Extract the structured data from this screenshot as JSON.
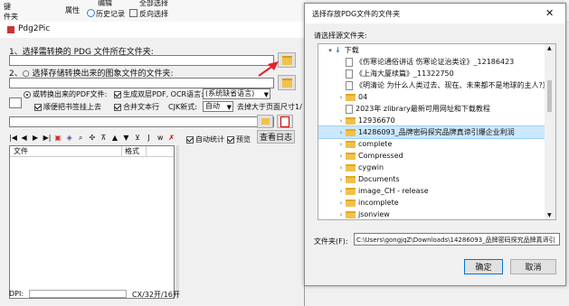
{
  "background_ribbon": {
    "key_fragment": "键",
    "folder_fragment": "件夹",
    "properties": "属性",
    "edit": "编辑",
    "history": "历史记录",
    "select_all": "全部选择",
    "invert_selection": "反向选择"
  },
  "pdg": {
    "title": "Pdg2Pic",
    "step1_label": "1、选择需转换的 PDG 文件所在文件夹:",
    "step2_label": "2、○ 选择存储转换出来的图象文件的文件夹:",
    "pdf_radio_label": "或转换出来的PDF文件:",
    "generate_pdf": "生成双层PDF, OCR语言:",
    "ocr_language": "(系统缺省语言)",
    "order_bookmark": "顺便把书签挂上去",
    "merge_text": "合并文本行",
    "cjk_label": "CJK新式:",
    "cjk_value": "自动",
    "page_size_label": "去掉大于页面尺寸1/",
    "auto_count": "自动统计",
    "preview": "预览",
    "view_log": "查看日志",
    "columns": [
      "文件",
      "格式"
    ],
    "dpi_label": "DPI:",
    "status_right": "CX/32开/16开"
  },
  "dialog": {
    "title": "选择存放PDG文件的文件夹",
    "close": "✕",
    "prompt": "请选择源文件夹:",
    "tree": [
      {
        "label": "下载",
        "type": "root"
      },
      {
        "label": "《伤寒论通俗讲话 伤寒论证治类诠》_12186423",
        "type": "doc"
      },
      {
        "label": "《上海大厦续篇》_11322750",
        "type": "doc"
      },
      {
        "label": "《明清论 为什么人类过去、现在、未来都不是地球的主人?》",
        "type": "doc"
      },
      {
        "label": "04",
        "type": "folder"
      },
      {
        "label": "2023年 zlibrary最新可用网址和下载教程",
        "type": "doc"
      },
      {
        "label": "12936670",
        "type": "folder"
      },
      {
        "label": "14286093_品牌密码探究品牌真谛引爆企业利润",
        "type": "selected"
      },
      {
        "label": "complete",
        "type": "folder"
      },
      {
        "label": "Compressed",
        "type": "folder"
      },
      {
        "label": "cygwin",
        "type": "folder"
      },
      {
        "label": "Documents",
        "type": "folder"
      },
      {
        "label": "image_CH - release",
        "type": "folder"
      },
      {
        "label": "incomplete",
        "type": "folder"
      },
      {
        "label": "jsonview",
        "type": "folder"
      }
    ],
    "folder_label": "文件夹(F):",
    "folder_value": "C:\\Users\\gongjqZ\\Downloads\\14286093_品牌密码探究品牌真谛引",
    "ok": "确定",
    "cancel": "取消"
  },
  "colors": {
    "selection_bg": "#cce8ff",
    "selection_border": "#99d1ff",
    "arrow_red": "#e8202a",
    "folder_yellow": "#f0c24b"
  }
}
